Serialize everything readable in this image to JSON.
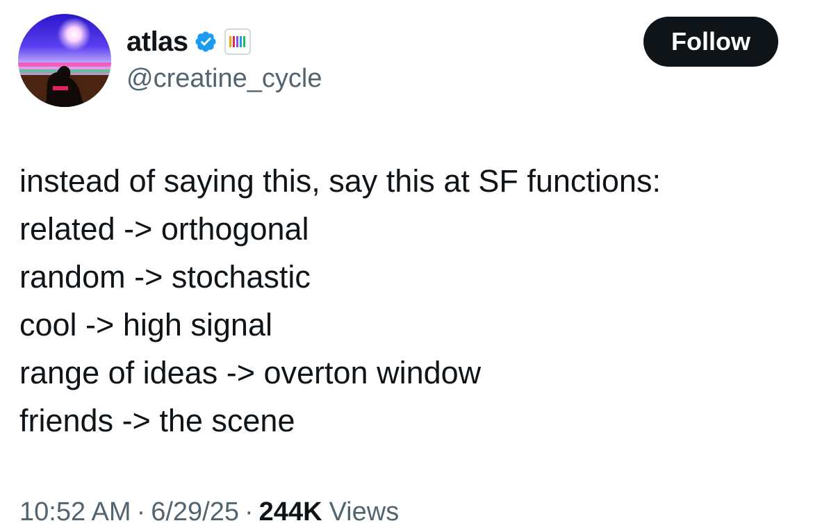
{
  "author": {
    "display_name": "atlas",
    "handle": "@creatine_cycle",
    "verified": true,
    "verified_badge_icon": "verified-check-icon",
    "affiliate_icon": "affiliate-bars-icon",
    "avatar_icon": "avatar-silhouette-landscape"
  },
  "follow_button": {
    "label": "Follow"
  },
  "tweet": {
    "lines": [
      "instead of saying this, say this at SF functions:",
      "related -> orthogonal",
      "random -> stochastic",
      "cool -> high signal",
      "range of ideas -> overton window",
      "friends -> the scene"
    ]
  },
  "meta": {
    "time": "10:52 AM",
    "separator": "·",
    "date": "6/29/25",
    "views_count": "244K",
    "views_label": "Views"
  },
  "colors": {
    "text_primary": "#0f1419",
    "text_secondary": "#536471",
    "verified_blue": "#1d9bf0",
    "button_bg": "#0f1419",
    "button_text": "#ffffff"
  }
}
